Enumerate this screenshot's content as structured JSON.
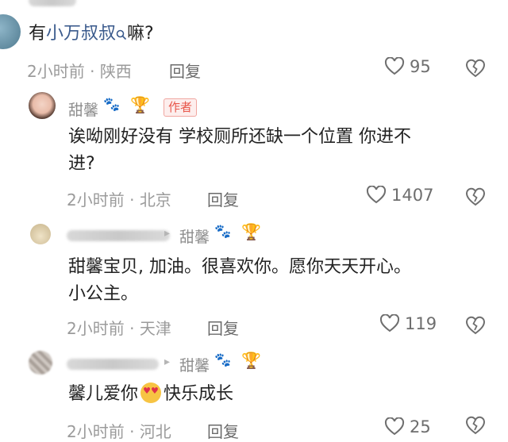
{
  "comments": [
    {
      "text_prefix": "有",
      "text_link": "小万叔叔",
      "text_suffix": "嘛?",
      "time": "2小时前",
      "location": "陕西",
      "reply": "回复",
      "likes": "95"
    },
    {
      "name": "甜馨",
      "author_tag": "作者",
      "line1": "诶呦刚好没有 学校厕所还缺一个位置 你进不",
      "line2": "进?",
      "time": "2小时前",
      "location": "北京",
      "reply": "回复",
      "likes": "1407"
    },
    {
      "reply_to": "甜馨",
      "line1": "甜馨宝贝, 加油。很喜欢你。愿你天天开心。",
      "line2": "小公主。",
      "time": "2小时前",
      "location": "天津",
      "reply": "回复",
      "likes": "119"
    },
    {
      "reply_to": "甜馨",
      "text_before": "馨儿爱你",
      "text_after": "快乐成长",
      "time": "2小时前",
      "location": "河北",
      "reply": "回复",
      "likes": "25"
    }
  ],
  "icons": {
    "like": "heart-outline-icon",
    "dislike": "broken-heart-icon",
    "search": "search-icon",
    "paw": "paw-icon",
    "trophy": "trophy-icon",
    "emoji": "heart-eyes-emoji-icon"
  },
  "colors": {
    "link": "#3a5a8c",
    "meta": "#9b9b9b",
    "author_tag": "#e8574b"
  }
}
